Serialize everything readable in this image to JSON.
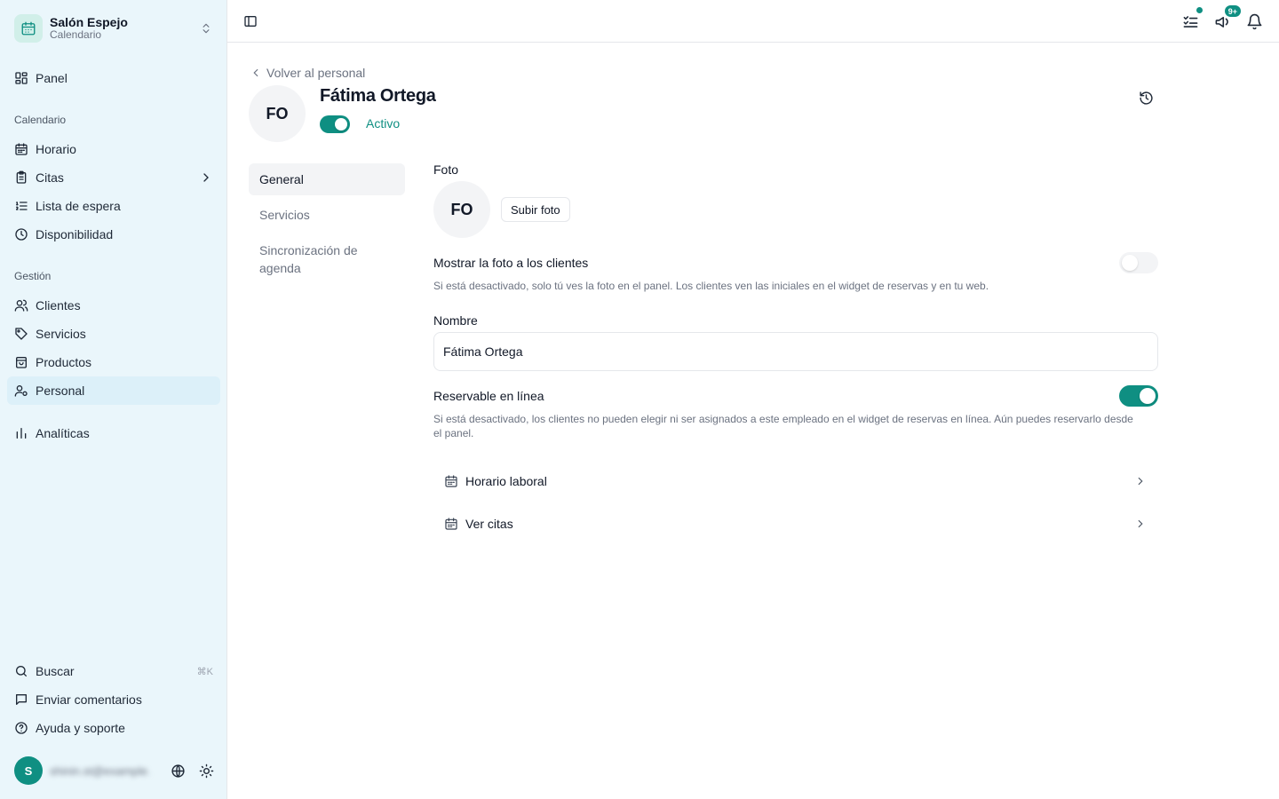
{
  "sidebar": {
    "brand": {
      "name": "Salón Espejo",
      "subtitle": "Calendario"
    },
    "panel_label": "Panel",
    "calendar_section": "Calendario",
    "calendar_items": [
      "Horario",
      "Citas",
      "Lista de espera",
      "Disponibilidad"
    ],
    "management_section": "Gestión",
    "management_items": [
      "Clientes",
      "Servicios",
      "Productos",
      "Personal"
    ],
    "analytics_label": "Analíticas",
    "search_label": "Buscar",
    "search_shortcut": "⌘K",
    "feedback_label": "Enviar comentarios",
    "help_label": "Ayuda y soporte",
    "user": {
      "initial": "S",
      "email": "shinin.st@example.com"
    },
    "active_item": "Personal"
  },
  "topbar": {
    "notification_badge": "9+"
  },
  "main": {
    "back_label": "Volver al personal",
    "staff": {
      "initials": "FO",
      "name": "Fátima Ortega",
      "active": true,
      "status_label": "Activo"
    },
    "tabs": [
      "General",
      "Servicios",
      "Sincronización de agenda"
    ],
    "active_tab": "General",
    "photo": {
      "label": "Foto",
      "initials": "FO",
      "upload_label": "Subir foto"
    },
    "show_photo": {
      "label": "Mostrar la foto a los clientes",
      "enabled": false,
      "help": "Si está desactivado, solo tú ves la foto en el panel. Los clientes ven las iniciales en el widget de reservas y en tu web."
    },
    "name_field": {
      "label": "Nombre",
      "value": "Fátima Ortega"
    },
    "bookable": {
      "label": "Reservable en línea",
      "enabled": true,
      "help": "Si está desactivado, los clientes no pueden elegir ni ser asignados a este empleado en el widget de reservas en línea. Aún puedes reservarlo desde el panel."
    },
    "links": [
      "Horario laboral",
      "Ver citas"
    ]
  },
  "colors": {
    "accent": "#0f8f82",
    "sidebar_bg": "#eaf6fb",
    "active_nav_bg": "#dcf0f9"
  }
}
